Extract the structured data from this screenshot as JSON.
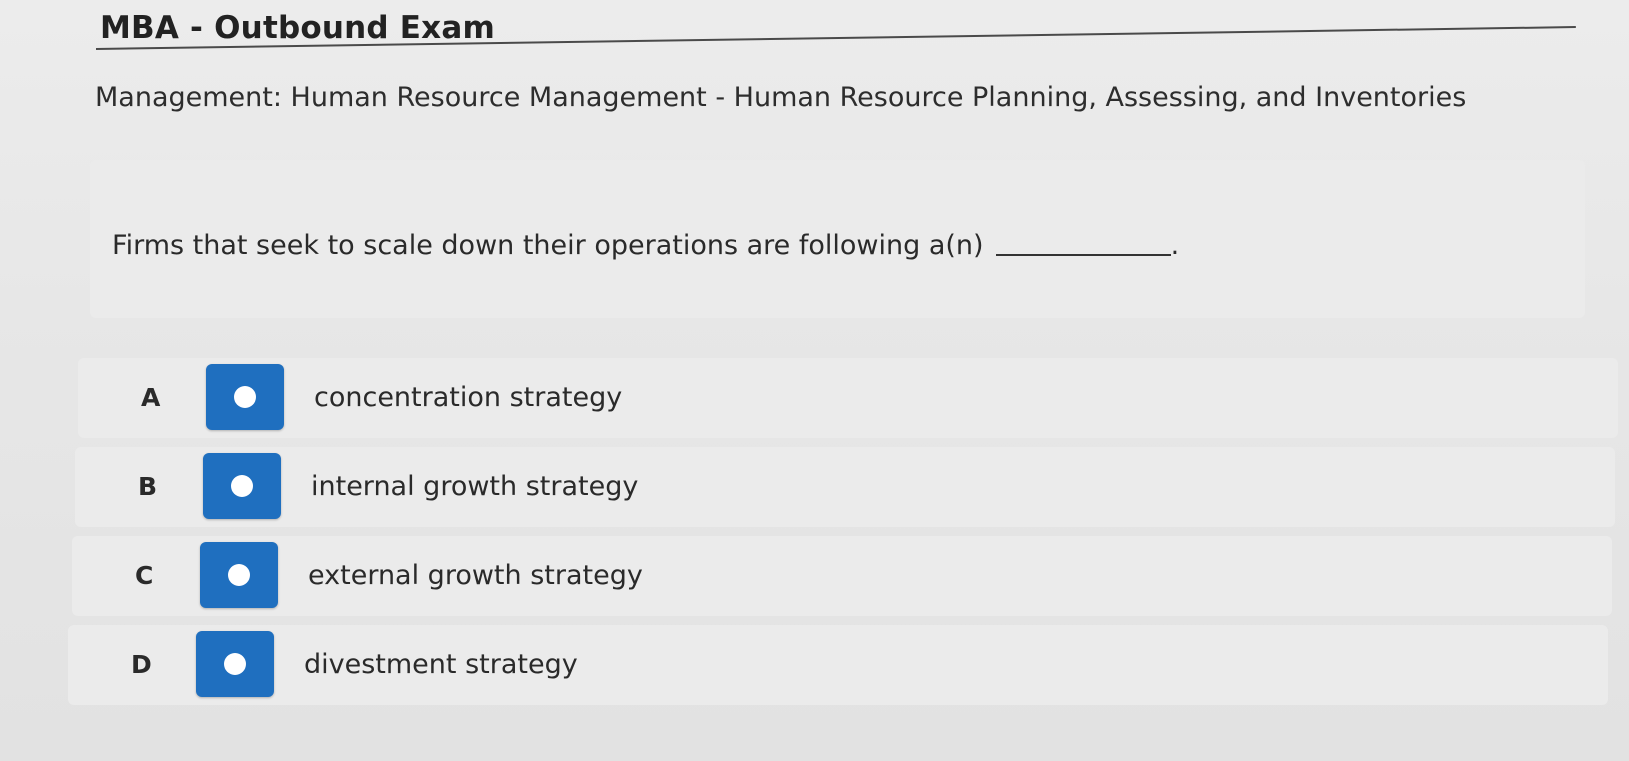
{
  "exam": {
    "title": "MBA - Outbound Exam"
  },
  "subject": "Management: Human Resource Management - Human Resource Planning, Assessing, and Inventories",
  "question": {
    "text": "Firms that seek to scale down their operations are following a(n)",
    "end_punctuation": "."
  },
  "options": [
    {
      "letter": "A",
      "text": "concentration strategy",
      "selected": false
    },
    {
      "letter": "B",
      "text": "internal growth strategy",
      "selected": false
    },
    {
      "letter": "C",
      "text": "external growth strategy",
      "selected": false
    },
    {
      "letter": "D",
      "text": "divestment strategy",
      "selected": false
    }
  ],
  "colors": {
    "radio_fill": "#1f6fbf",
    "radio_dot": "#ffffff",
    "background": "#e4e4e4",
    "card": "#ebebeb"
  },
  "icons": {
    "radio": "radio-button-icon"
  }
}
